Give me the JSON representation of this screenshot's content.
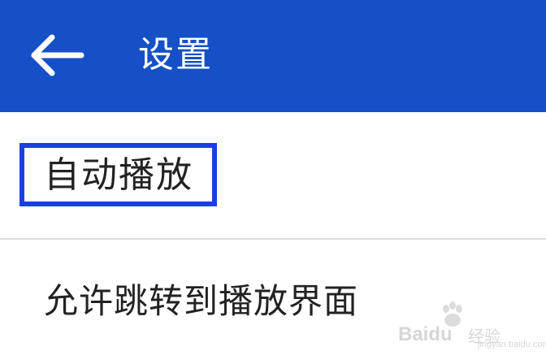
{
  "app_bar": {
    "title": "设置",
    "back_icon": "arrow-left-icon",
    "background_color": "#1550c6"
  },
  "section": {
    "title": "自动播放",
    "highlight_color": "#1a3fe0"
  },
  "settings": {
    "items": [
      {
        "label": "允许跳转到播放界面"
      }
    ]
  },
  "watermark": {
    "brand": "Baidu",
    "sub": "经验",
    "url": "jingyan.baidu.com"
  }
}
